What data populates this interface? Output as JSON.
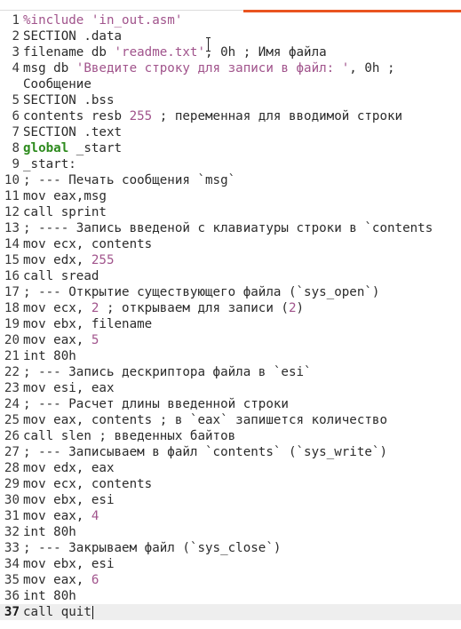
{
  "editor": {
    "lines": [
      {
        "n": "1",
        "parts": [
          [
            "str",
            "%include 'in_out.asm'"
          ]
        ]
      },
      {
        "n": "2",
        "parts": [
          [
            "t",
            "SECTION .data"
          ]
        ]
      },
      {
        "n": "3",
        "parts": [
          [
            "t",
            "filename db "
          ],
          [
            "str",
            "'readme.txt'"
          ],
          [
            "t",
            ", 0h ; Имя файла"
          ]
        ]
      },
      {
        "n": "4",
        "parts": [
          [
            "t",
            "msg db "
          ],
          [
            "str",
            "'Введите строку для записи в файл: '"
          ],
          [
            "t",
            ", 0h ;"
          ]
        ]
      },
      {
        "n": "",
        "parts": [
          [
            "t",
            "Сообщение"
          ]
        ],
        "cont": true
      },
      {
        "n": "5",
        "parts": [
          [
            "t",
            "SECTION .bss"
          ]
        ]
      },
      {
        "n": "6",
        "parts": [
          [
            "t",
            "contents resb "
          ],
          [
            "num",
            "255"
          ],
          [
            "t",
            " ; переменная для вводимой строки"
          ]
        ]
      },
      {
        "n": "7",
        "parts": [
          [
            "t",
            "SECTION .text"
          ]
        ]
      },
      {
        "n": "8",
        "parts": [
          [
            "kw",
            "global"
          ],
          [
            "t",
            " _start"
          ]
        ]
      },
      {
        "n": "9",
        "parts": [
          [
            "t",
            "_start:"
          ]
        ]
      },
      {
        "n": "10",
        "parts": [
          [
            "t",
            "; --- Печать сообщения `msg`"
          ]
        ]
      },
      {
        "n": "11",
        "parts": [
          [
            "t",
            "mov eax,msg"
          ]
        ]
      },
      {
        "n": "12",
        "parts": [
          [
            "t",
            "call sprint"
          ]
        ]
      },
      {
        "n": "13",
        "parts": [
          [
            "t",
            "; ---- Запись введеной с клавиатуры строки в `contents"
          ]
        ]
      },
      {
        "n": "14",
        "parts": [
          [
            "t",
            "mov ecx, contents"
          ]
        ]
      },
      {
        "n": "15",
        "parts": [
          [
            "t",
            "mov edx, "
          ],
          [
            "num",
            "255"
          ]
        ]
      },
      {
        "n": "16",
        "parts": [
          [
            "t",
            "call sread"
          ]
        ]
      },
      {
        "n": "17",
        "parts": [
          [
            "t",
            "; --- Открытие существующего файла (`sys_open`)"
          ]
        ]
      },
      {
        "n": "18",
        "parts": [
          [
            "t",
            "mov ecx, "
          ],
          [
            "num",
            "2"
          ],
          [
            "t",
            " ; открываем для записи ("
          ],
          [
            "num",
            "2"
          ],
          [
            "t",
            ")"
          ]
        ]
      },
      {
        "n": "19",
        "parts": [
          [
            "t",
            "mov ebx, filename"
          ]
        ]
      },
      {
        "n": "20",
        "parts": [
          [
            "t",
            "mov eax, "
          ],
          [
            "num",
            "5"
          ]
        ]
      },
      {
        "n": "21",
        "parts": [
          [
            "t",
            "int 80h"
          ]
        ]
      },
      {
        "n": "22",
        "parts": [
          [
            "t",
            "; --- Запись дескриптора файла в `esi`"
          ]
        ]
      },
      {
        "n": "23",
        "parts": [
          [
            "t",
            "mov esi, eax"
          ]
        ]
      },
      {
        "n": "24",
        "parts": [
          [
            "t",
            "; --- Расчет длины введенной строки"
          ]
        ]
      },
      {
        "n": "25",
        "parts": [
          [
            "t",
            "mov eax, contents ; в `eax` запишется количество"
          ]
        ]
      },
      {
        "n": "26",
        "parts": [
          [
            "t",
            "call slen ; введенных байтов"
          ]
        ]
      },
      {
        "n": "27",
        "parts": [
          [
            "t",
            "; --- Записываем в файл `contents` (`sys_write`)"
          ]
        ]
      },
      {
        "n": "28",
        "parts": [
          [
            "t",
            "mov edx, eax"
          ]
        ]
      },
      {
        "n": "29",
        "parts": [
          [
            "t",
            "mov ecx, contents"
          ]
        ]
      },
      {
        "n": "30",
        "parts": [
          [
            "t",
            "mov ebx, esi"
          ]
        ]
      },
      {
        "n": "31",
        "parts": [
          [
            "t",
            "mov eax, "
          ],
          [
            "num",
            "4"
          ]
        ]
      },
      {
        "n": "32",
        "parts": [
          [
            "t",
            "int 80h"
          ]
        ]
      },
      {
        "n": "33",
        "parts": [
          [
            "t",
            "; --- Закрываем файл (`sys_close`)"
          ]
        ]
      },
      {
        "n": "34",
        "parts": [
          [
            "t",
            "mov ebx, esi"
          ]
        ]
      },
      {
        "n": "35",
        "parts": [
          [
            "t",
            "mov eax, "
          ],
          [
            "num",
            "6"
          ]
        ]
      },
      {
        "n": "36",
        "parts": [
          [
            "t",
            "int 80h"
          ]
        ]
      },
      {
        "n": "37",
        "parts": [
          [
            "t",
            "call quit"
          ]
        ],
        "current": true
      }
    ]
  },
  "colors": {
    "accent": "#e95420",
    "keyword": "#2e8b1e",
    "string_number": "#a1548c",
    "current_line_bg": "#eeeeee"
  }
}
